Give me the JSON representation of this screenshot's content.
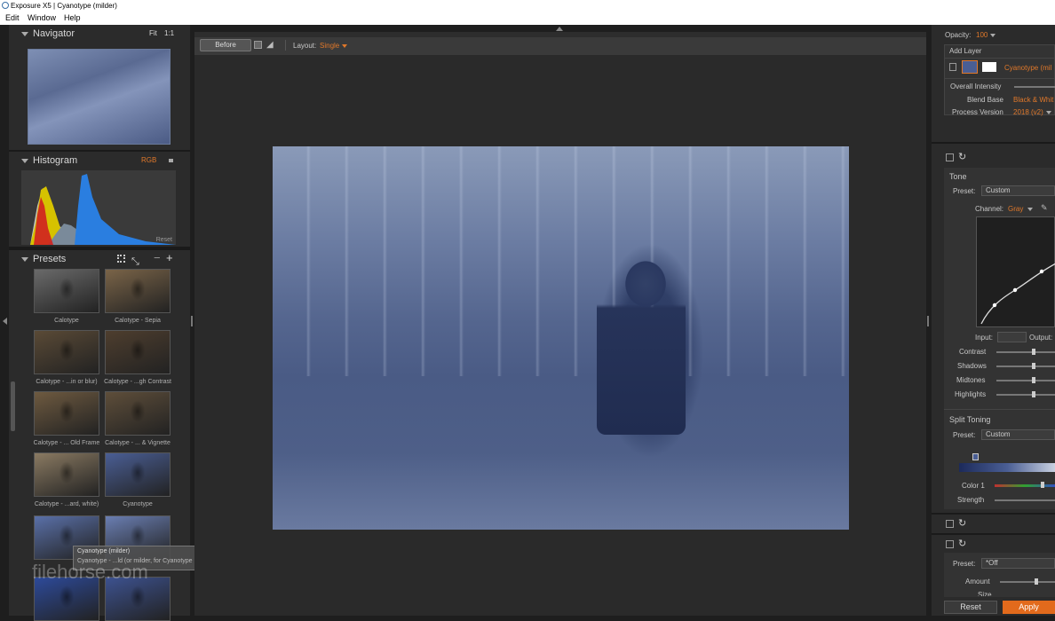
{
  "window": {
    "title": "Exposure X5 | Cyanotype (milder)"
  },
  "menu": [
    "Edit",
    "Window",
    "Help"
  ],
  "navigator": {
    "title": "Navigator",
    "fit": "Fit",
    "one_to_one": "1:1"
  },
  "histogram": {
    "title": "Histogram",
    "channel": "RGB",
    "reset": "Reset"
  },
  "presets": {
    "title": "Presets",
    "items": [
      {
        "label": "Calotype",
        "tone": "#6a6a6a"
      },
      {
        "label": "Calotype - Sepia",
        "tone": "#7a6448"
      },
      {
        "label": "Calotype - ...in or blur)",
        "tone": "#5a4a36"
      },
      {
        "label": "Calotype - ...gh Contrast",
        "tone": "#4e3e2e"
      },
      {
        "label": "Calotype - ... Old Frame",
        "tone": "#6e5a40"
      },
      {
        "label": "Calotype - ... & Vignette",
        "tone": "#5e4e3a"
      },
      {
        "label": "Calotype - ...ard, white)",
        "tone": "#8a7a62"
      },
      {
        "label": "Cyanotype",
        "tone": "#4a5e94"
      },
      {
        "label": "",
        "tone": "#5a70a8"
      },
      {
        "label": "",
        "tone": "#6a7eb2"
      },
      {
        "label": "",
        "tone": "#2d4a9a"
      },
      {
        "label": "",
        "tone": "#3d5290"
      }
    ]
  },
  "tooltip": {
    "line1": "Cyanotype (milder)",
    "line2": "Cyanotype - ...ld (or milder, for Cyanotype"
  },
  "watermark": "filehorse.com",
  "toolbar": {
    "before": "Before",
    "layout_label": "Layout:",
    "layout_value": "Single"
  },
  "right": {
    "opacity_label": "Opacity:",
    "opacity_value": "100",
    "add_layer": "Add Layer",
    "layer_name": "Cyanotype (mil",
    "overall_intensity": "Overall Intensity",
    "blend_base_label": "Blend Base",
    "blend_base_value": "Black & Whit",
    "process_version_label": "Process Version",
    "process_version_value": "2018 (v2)",
    "tone_title": "Tone",
    "preset_label": "Preset:",
    "preset_value": "Custom",
    "channel_label": "Channel:",
    "channel_value": "Gray",
    "input_label": "Input:",
    "output_label": "Output:",
    "sliders": [
      "Contrast",
      "Shadows",
      "Midtones",
      "Highlights"
    ],
    "split_toning_title": "Split Toning",
    "split_preset_label": "Preset:",
    "split_preset_value": "Custom",
    "color1_label": "Color 1",
    "strength_label": "Strength",
    "bottom_preset_label": "Preset:",
    "bottom_preset_value": "*Off",
    "amount_label": "Amount",
    "size_label": "Size",
    "reset_button": "Reset",
    "apply_button": "Apply"
  }
}
